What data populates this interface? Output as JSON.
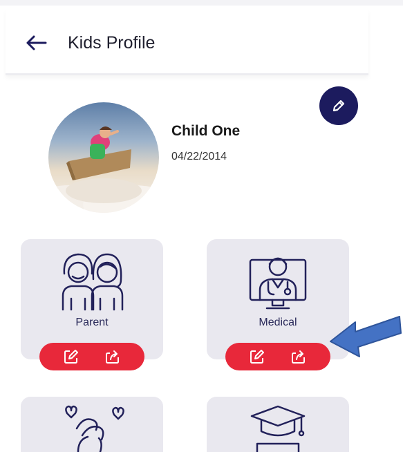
{
  "header": {
    "title": "Kids Profile"
  },
  "profile": {
    "name": "Child One",
    "dob": "04/22/2014"
  },
  "cards": [
    {
      "label": "Parent",
      "icon": "parents-icon"
    },
    {
      "label": "Medical",
      "icon": "doctor-monitor-icon"
    },
    {
      "label": "",
      "icon": "hands-hearts-icon"
    },
    {
      "label": "",
      "icon": "graduation-cap-icon"
    }
  ],
  "colors": {
    "accent": "#1c1b5e",
    "action": "#e8283a",
    "card": "#e9e8ef",
    "annotation_arrow": "#4472c4"
  }
}
